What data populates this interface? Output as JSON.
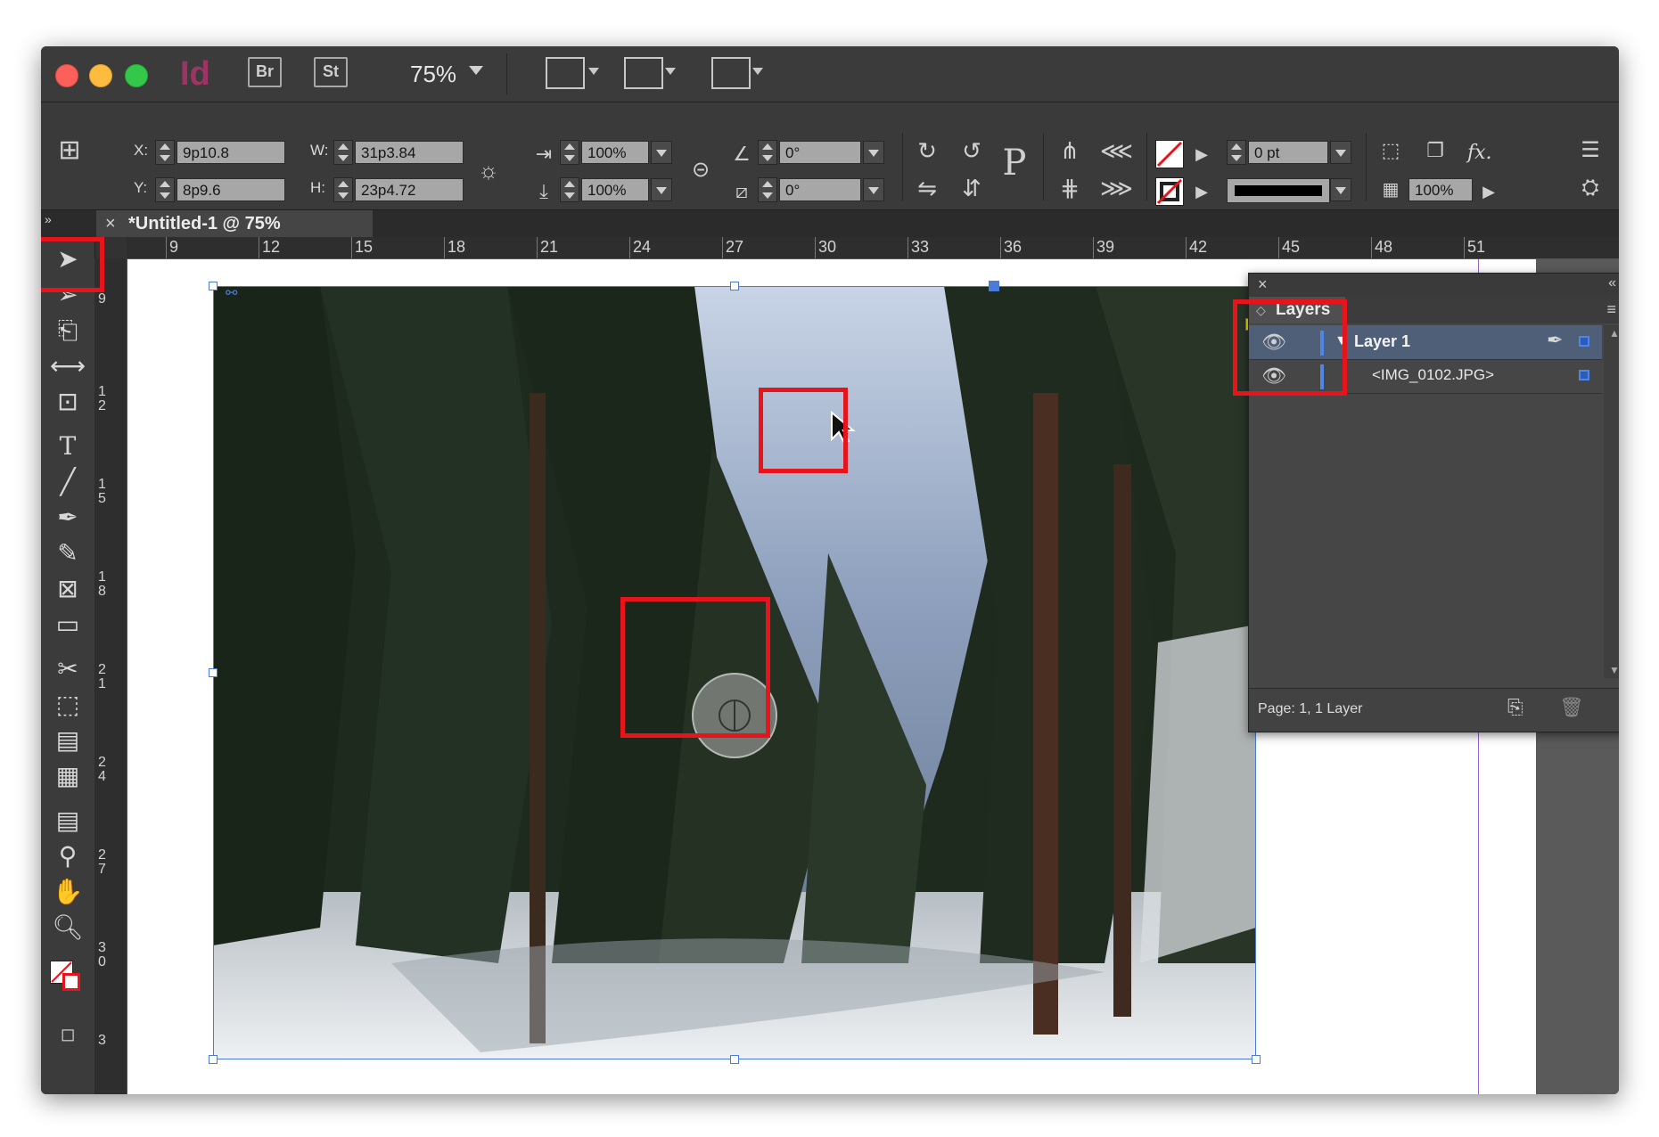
{
  "app": {
    "logo": "Id",
    "badges": [
      "Br",
      "St"
    ],
    "zoom": "75%"
  },
  "control": {
    "x_label": "X:",
    "x_value": "9p10.8",
    "y_label": "Y:",
    "y_value": "8p9.6",
    "w_label": "W:",
    "w_value": "31p3.84",
    "h_label": "H:",
    "h_value": "23p4.72",
    "scale_x": "100%",
    "scale_y": "100%",
    "rotate": "0°",
    "shear": "0°",
    "stroke_weight": "0 pt",
    "opacity": "100%",
    "fx": "fx."
  },
  "document": {
    "tab_title": "*Untitled-1 @ 75%",
    "close": "×"
  },
  "ruler": {
    "horizontal": [
      "9",
      "12",
      "15",
      "18",
      "21",
      "24",
      "27",
      "30",
      "33",
      "36",
      "39",
      "42",
      "45",
      "48",
      "51"
    ],
    "vertical": [
      {
        "lines": [
          "9"
        ]
      },
      {
        "lines": [
          "1",
          "2"
        ]
      },
      {
        "lines": [
          "1",
          "5"
        ]
      },
      {
        "lines": [
          "1",
          "8"
        ]
      },
      {
        "lines": [
          "2",
          "1"
        ]
      },
      {
        "lines": [
          "2",
          "4"
        ]
      },
      {
        "lines": [
          "2",
          "7"
        ]
      },
      {
        "lines": [
          "3",
          "0"
        ]
      },
      {
        "lines": [
          "3"
        ]
      }
    ]
  },
  "layers_panel": {
    "close": "×",
    "tab": "Layers",
    "layers": [
      {
        "name": "Layer 1",
        "type": "layer"
      },
      {
        "name": "<IMG_0102.JPG>",
        "type": "item"
      }
    ],
    "footer": "Page: 1, 1 Layer"
  },
  "colors": {
    "highlight": "#e8141b",
    "selection": "#4a7bd6",
    "layer_color": "#4f86e6",
    "app_accent": "#9d3564"
  },
  "icons": {
    "tools": [
      "selection-tool-icon",
      "direct-selection-tool-icon",
      "page-tool-icon",
      "gap-tool-icon",
      "content-collector-icon",
      "type-tool-icon",
      "line-tool-icon",
      "pen-tool-icon",
      "pencil-tool-icon",
      "rectangle-frame-tool-icon",
      "rectangle-tool-icon",
      "scissors-tool-icon",
      "free-transform-tool-icon",
      "gradient-swatch-tool-icon",
      "gradient-feather-tool-icon",
      "note-tool-icon",
      "eyedropper-tool-icon",
      "hand-tool-icon",
      "zoom-tool-icon"
    ]
  }
}
